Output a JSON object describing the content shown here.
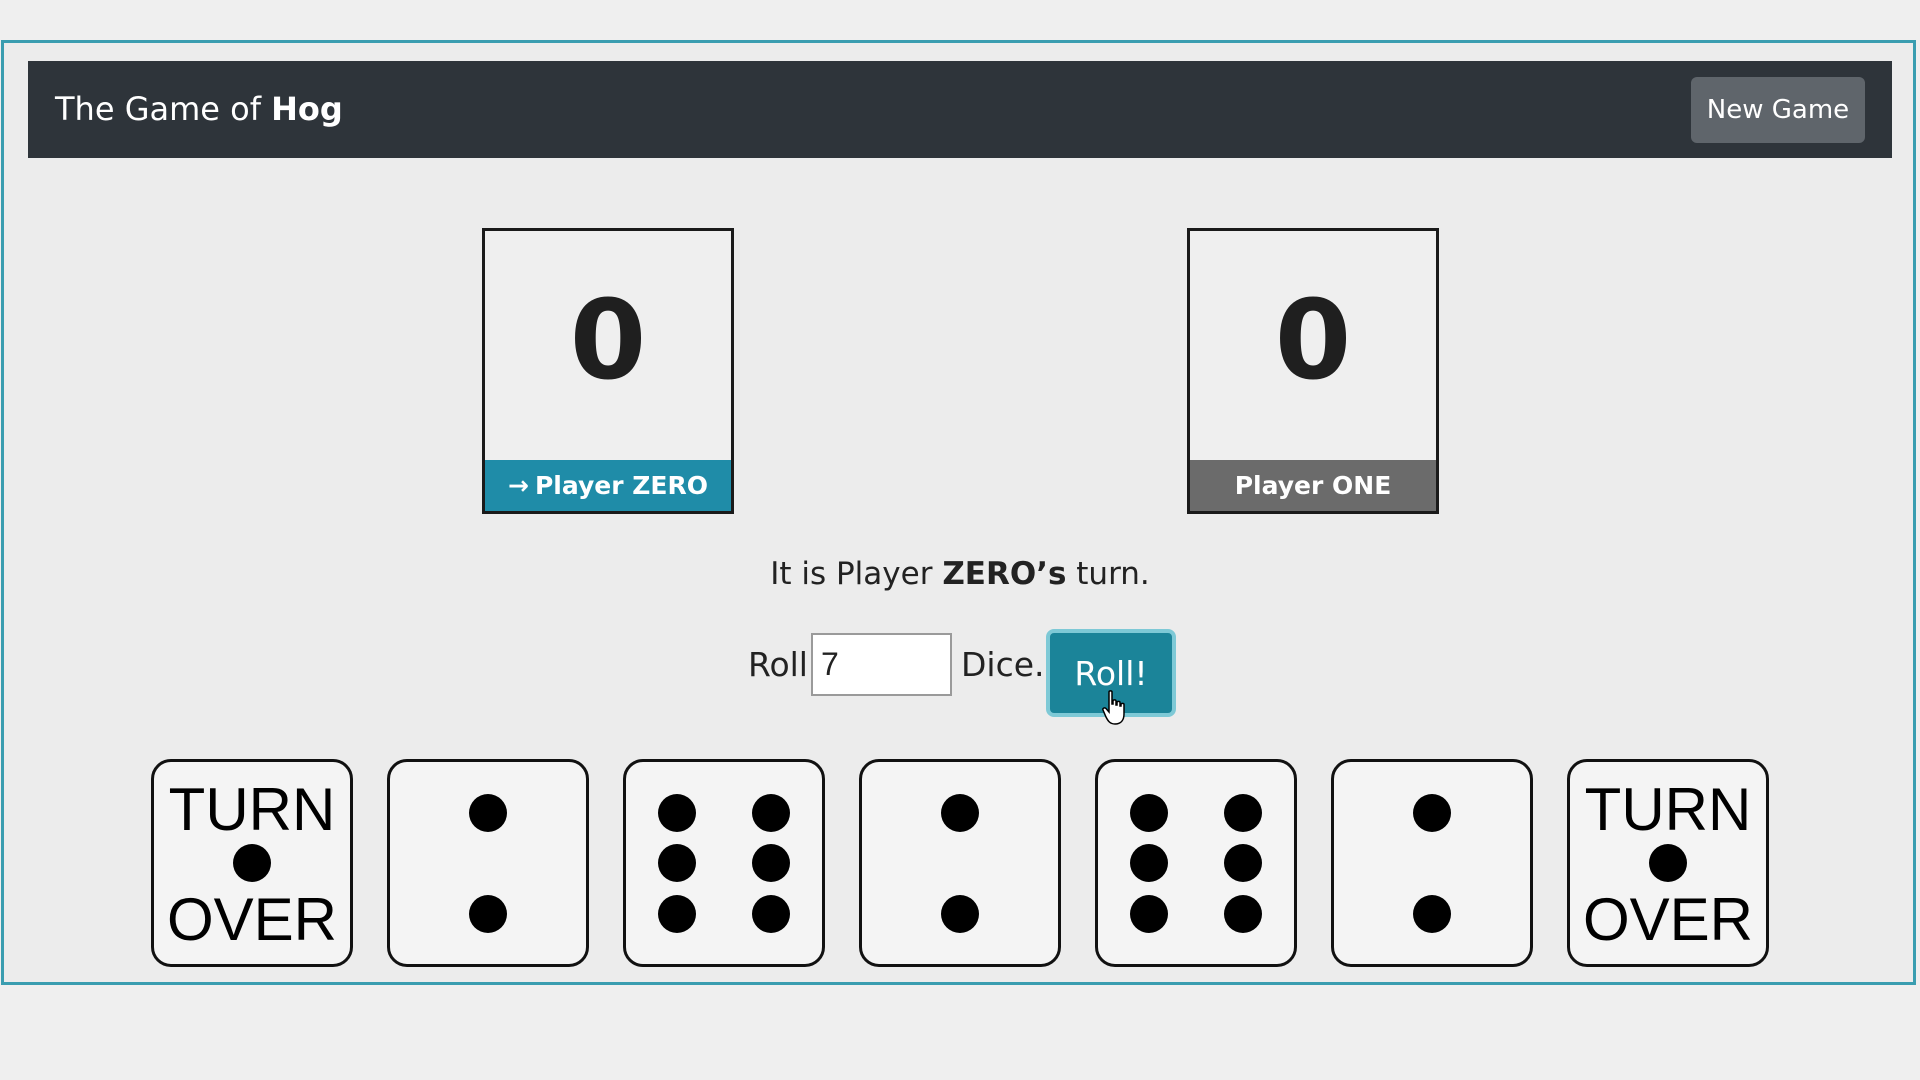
{
  "header": {
    "brand_prefix": "The Game of ",
    "brand_name": "Hog",
    "new_game_label": "New Game"
  },
  "players": [
    {
      "score": "0",
      "arrow": "→",
      "label": "Player ZERO",
      "active": true,
      "color": "#1f8ca8"
    },
    {
      "score": "0",
      "label": "Player ONE",
      "active": false,
      "color": "#6b6b6b"
    }
  ],
  "turn": {
    "prefix": "It is Player ",
    "player": "ZERO’s",
    "suffix": " turn."
  },
  "roll": {
    "roll_label": "Roll",
    "dice_count": "7",
    "dice_label": "Dice.",
    "button_label": "Roll!"
  },
  "dice": [
    {
      "value": 1,
      "face": "turnover",
      "top_text": "TURN",
      "bottom_text": "OVER"
    },
    {
      "value": 2,
      "face": "pips"
    },
    {
      "value": 6,
      "face": "pips"
    },
    {
      "value": 2,
      "face": "pips"
    },
    {
      "value": 6,
      "face": "pips"
    },
    {
      "value": 2,
      "face": "pips"
    },
    {
      "value": 1,
      "face": "turnover",
      "top_text": "TURN",
      "bottom_text": "OVER"
    }
  ],
  "colors": {
    "navbar": "#2e343a",
    "accent": "#1b8499",
    "frame_border": "#3a9db0"
  }
}
